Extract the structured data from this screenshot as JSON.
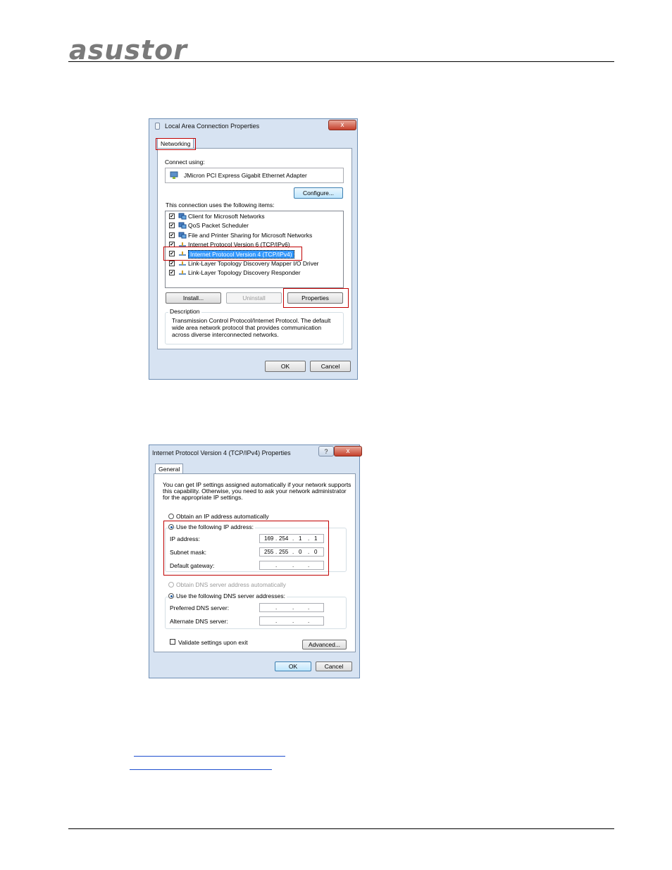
{
  "header": {
    "logo_text": "asustor"
  },
  "dialog1": {
    "title": "Local Area Connection Properties",
    "close_label": "x",
    "tab_label": "Networking",
    "connect_using_label": "Connect using:",
    "adapter_name": "JMicron PCI Express Gigabit Ethernet Adapter",
    "configure_label": "Configure...",
    "items_label": "This connection uses the following items:",
    "items": [
      {
        "label": "Client for Microsoft Networks",
        "checked": true,
        "icon": "network-client-icon"
      },
      {
        "label": "QoS Packet Scheduler",
        "checked": true,
        "icon": "network-service-icon"
      },
      {
        "label": "File and Printer Sharing for Microsoft Networks",
        "checked": true,
        "icon": "network-service-icon"
      },
      {
        "label": "Internet Protocol Version 6 (TCP/IPv6)",
        "checked": true,
        "icon": "protocol-icon"
      },
      {
        "label": "Internet Protocol Version 4 (TCP/IPv4)",
        "checked": true,
        "icon": "protocol-icon",
        "selected": true
      },
      {
        "label": "Link-Layer Topology Discovery Mapper I/O Driver",
        "checked": true,
        "icon": "protocol-icon"
      },
      {
        "label": "Link-Layer Topology Discovery Responder",
        "checked": true,
        "icon": "protocol-icon"
      }
    ],
    "install_label": "Install...",
    "uninstall_label": "Uninstall",
    "properties_label": "Properties",
    "description_label": "Description",
    "description_lines": [
      "Transmission Control Protocol/Internet Protocol. The default",
      "wide area network protocol that provides communication",
      "across diverse interconnected networks."
    ],
    "ok_label": "OK",
    "cancel_label": "Cancel"
  },
  "dialog2": {
    "title": "Internet Protocol Version 4 (TCP/IPv4) Properties",
    "help_label": "?",
    "close_label": "x",
    "tab_label": "General",
    "intro_lines": [
      "You can get IP settings assigned automatically if your network supports",
      "this capability. Otherwise, you need to ask your network administrator",
      "for the appropriate IP settings."
    ],
    "obtain_ip_label": "Obtain an IP address automatically",
    "use_ip_label": "Use the following IP address:",
    "ip_address_label": "IP address:",
    "ip_address": [
      "169",
      "254",
      "1",
      "1"
    ],
    "subnet_label": "Subnet mask:",
    "subnet_mask": [
      "255",
      "255",
      "0",
      "0"
    ],
    "gateway_label": "Default gateway:",
    "obtain_dns_label": "Obtain DNS server address automatically",
    "use_dns_label": "Use the following DNS server addresses:",
    "preferred_dns_label": "Preferred DNS server:",
    "alternate_dns_label": "Alternate DNS server:",
    "validate_label": "Validate settings upon exit",
    "advanced_label": "Advanced...",
    "ok_label": "OK",
    "cancel_label": "Cancel"
  },
  "colors": {
    "highlight_red": "#c00000",
    "link_blue": "#1f4fcf",
    "selection_blue": "#3399ff"
  }
}
